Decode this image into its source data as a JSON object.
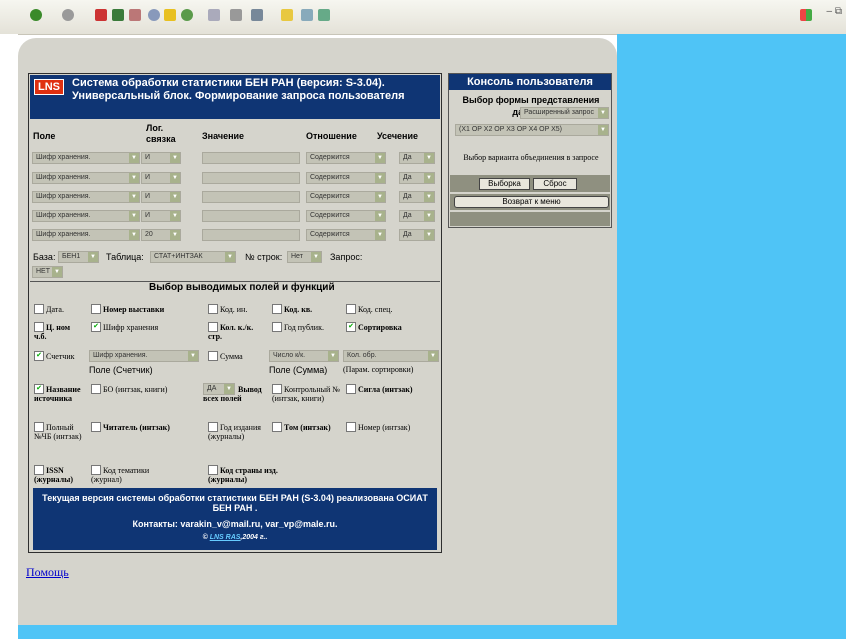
{
  "header": {
    "logo": "LNS",
    "title": "Система обработки статистики БЕН РАН (версия: S-3.04). Универсальный блок. Формирование запроса пользователя"
  },
  "columns": {
    "field": "Поле",
    "logic": "Лог. связка",
    "value": "Значение",
    "relation": "Отношение",
    "trunc": "Усечение"
  },
  "rows": [
    {
      "field": "Шифр хранения.",
      "logic": "И",
      "relation": "Содержится",
      "trunc": "Да"
    },
    {
      "field": "Шифр хранения.",
      "logic": "И",
      "relation": "Содержится",
      "trunc": "Да"
    },
    {
      "field": "Шифр хранения.",
      "logic": "И",
      "relation": "Содержится",
      "trunc": "Да"
    },
    {
      "field": "Шифр хранения.",
      "logic": "И",
      "relation": "Содержится",
      "trunc": "Да"
    },
    {
      "field": "Шифр хранения.",
      "logic": "20",
      "relation": "Содержится",
      "trunc": "Да"
    }
  ],
  "params": {
    "base_label": "База:",
    "base": "БЕН1",
    "table_label": "Таблица:",
    "table": "СТАТ+ИНТЗАК",
    "nrows_label": "№ строк:",
    "nrows": "Нет",
    "query_label": "Запрос:",
    "query": "НЕТ"
  },
  "output": {
    "title": "Выбор выводимых полей и функций",
    "r1": [
      "Дата.",
      "Номер выставки",
      "Код. ин.",
      "Код. кв.",
      "Код. спец."
    ],
    "r2": [
      "Ц. ном ч.б.",
      "Шифр хранения",
      "Кол. к./к. стр.",
      "Год публик.",
      "Сортировка"
    ],
    "r3_counter": "Счетчик",
    "r3_sel1": "Шифр хранения.",
    "r3_sub1": "Поле (Счетчик)",
    "r3_sum": "Сумма",
    "r3_sel2": "Число к/к.",
    "r3_sub2": "Поле (Сумма)",
    "r3_sel3": "Кол. обр.",
    "r3_sub3": "(Парам. сортировки)",
    "r4_name": "Название источника",
    "r4_bo": "БО (интзак, книги)",
    "r4_da": "ДА",
    "r4_all": "Вывод всех полей",
    "r4_ctrl": "Контрольный № (интзак, книги)",
    "r4_sigla": "Сигла (интзак)",
    "r5": [
      "Полный №ЧБ (интзак)",
      "Читатель (интзак)",
      "Год издания (журналы)",
      "Том (интзак)",
      "Номер (интзак)"
    ],
    "r6": [
      "ISSN (журналы)",
      "Код тематики (журнал)",
      "Код страны изд. (журналы)"
    ]
  },
  "footer": {
    "l1": "Текущая версия системы  обработки статистики БЕН РАН (S-3.04) реализована ОСИАТ БЕН РАН .",
    "l2": "Контакты: varakin_v@mail.ru, var_vp@male.ru.",
    "l3a": "© ",
    "l3link": "LNS RAS",
    "l3b": ",2004 г.."
  },
  "console": {
    "title": "Консоль пользователя",
    "form_label": "Выбор формы представления данных:",
    "form_value": "Расширенный запрос",
    "combo": "(X1 OP X2 OP X3 OP X4 OP X5)",
    "combine_label": "Выбор варианта объединения в запросе",
    "btn_select": "Выборка",
    "btn_reset": "Сброс",
    "btn_back": "Возврат к меню"
  },
  "help": "Помощь",
  "colors": {
    "header": "#0f3574",
    "accent_bg": "#4fc4f6",
    "panel": "#d5d4cc"
  }
}
